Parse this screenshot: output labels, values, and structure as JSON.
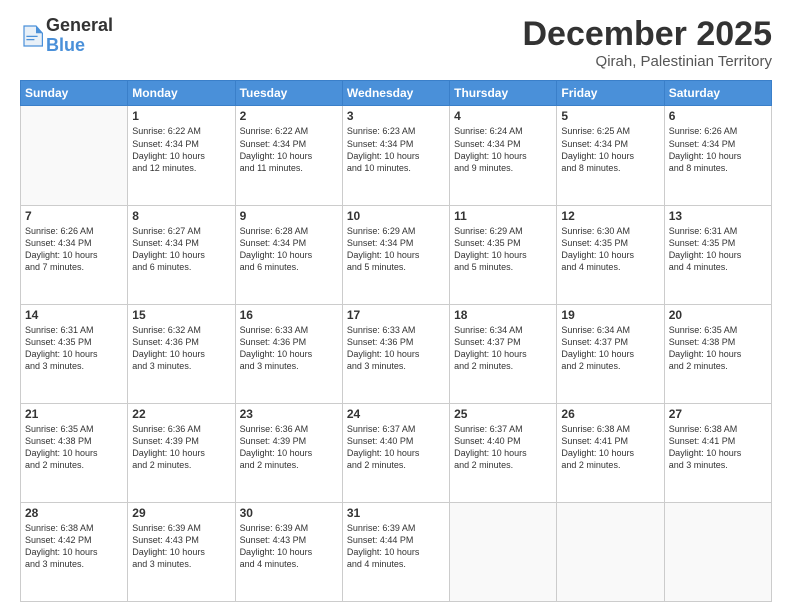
{
  "logo": {
    "general": "General",
    "blue": "Blue"
  },
  "header": {
    "title": "December 2025",
    "subtitle": "Qirah, Palestinian Territory"
  },
  "days_of_week": [
    "Sunday",
    "Monday",
    "Tuesday",
    "Wednesday",
    "Thursday",
    "Friday",
    "Saturday"
  ],
  "weeks": [
    [
      {
        "day": "",
        "info": ""
      },
      {
        "day": "1",
        "info": "Sunrise: 6:22 AM\nSunset: 4:34 PM\nDaylight: 10 hours\nand 12 minutes."
      },
      {
        "day": "2",
        "info": "Sunrise: 6:22 AM\nSunset: 4:34 PM\nDaylight: 10 hours\nand 11 minutes."
      },
      {
        "day": "3",
        "info": "Sunrise: 6:23 AM\nSunset: 4:34 PM\nDaylight: 10 hours\nand 10 minutes."
      },
      {
        "day": "4",
        "info": "Sunrise: 6:24 AM\nSunset: 4:34 PM\nDaylight: 10 hours\nand 9 minutes."
      },
      {
        "day": "5",
        "info": "Sunrise: 6:25 AM\nSunset: 4:34 PM\nDaylight: 10 hours\nand 8 minutes."
      },
      {
        "day": "6",
        "info": "Sunrise: 6:26 AM\nSunset: 4:34 PM\nDaylight: 10 hours\nand 8 minutes."
      }
    ],
    [
      {
        "day": "7",
        "info": "Sunrise: 6:26 AM\nSunset: 4:34 PM\nDaylight: 10 hours\nand 7 minutes."
      },
      {
        "day": "8",
        "info": "Sunrise: 6:27 AM\nSunset: 4:34 PM\nDaylight: 10 hours\nand 6 minutes."
      },
      {
        "day": "9",
        "info": "Sunrise: 6:28 AM\nSunset: 4:34 PM\nDaylight: 10 hours\nand 6 minutes."
      },
      {
        "day": "10",
        "info": "Sunrise: 6:29 AM\nSunset: 4:34 PM\nDaylight: 10 hours\nand 5 minutes."
      },
      {
        "day": "11",
        "info": "Sunrise: 6:29 AM\nSunset: 4:35 PM\nDaylight: 10 hours\nand 5 minutes."
      },
      {
        "day": "12",
        "info": "Sunrise: 6:30 AM\nSunset: 4:35 PM\nDaylight: 10 hours\nand 4 minutes."
      },
      {
        "day": "13",
        "info": "Sunrise: 6:31 AM\nSunset: 4:35 PM\nDaylight: 10 hours\nand 4 minutes."
      }
    ],
    [
      {
        "day": "14",
        "info": "Sunrise: 6:31 AM\nSunset: 4:35 PM\nDaylight: 10 hours\nand 3 minutes."
      },
      {
        "day": "15",
        "info": "Sunrise: 6:32 AM\nSunset: 4:36 PM\nDaylight: 10 hours\nand 3 minutes."
      },
      {
        "day": "16",
        "info": "Sunrise: 6:33 AM\nSunset: 4:36 PM\nDaylight: 10 hours\nand 3 minutes."
      },
      {
        "day": "17",
        "info": "Sunrise: 6:33 AM\nSunset: 4:36 PM\nDaylight: 10 hours\nand 3 minutes."
      },
      {
        "day": "18",
        "info": "Sunrise: 6:34 AM\nSunset: 4:37 PM\nDaylight: 10 hours\nand 2 minutes."
      },
      {
        "day": "19",
        "info": "Sunrise: 6:34 AM\nSunset: 4:37 PM\nDaylight: 10 hours\nand 2 minutes."
      },
      {
        "day": "20",
        "info": "Sunrise: 6:35 AM\nSunset: 4:38 PM\nDaylight: 10 hours\nand 2 minutes."
      }
    ],
    [
      {
        "day": "21",
        "info": "Sunrise: 6:35 AM\nSunset: 4:38 PM\nDaylight: 10 hours\nand 2 minutes."
      },
      {
        "day": "22",
        "info": "Sunrise: 6:36 AM\nSunset: 4:39 PM\nDaylight: 10 hours\nand 2 minutes."
      },
      {
        "day": "23",
        "info": "Sunrise: 6:36 AM\nSunset: 4:39 PM\nDaylight: 10 hours\nand 2 minutes."
      },
      {
        "day": "24",
        "info": "Sunrise: 6:37 AM\nSunset: 4:40 PM\nDaylight: 10 hours\nand 2 minutes."
      },
      {
        "day": "25",
        "info": "Sunrise: 6:37 AM\nSunset: 4:40 PM\nDaylight: 10 hours\nand 2 minutes."
      },
      {
        "day": "26",
        "info": "Sunrise: 6:38 AM\nSunset: 4:41 PM\nDaylight: 10 hours\nand 2 minutes."
      },
      {
        "day": "27",
        "info": "Sunrise: 6:38 AM\nSunset: 4:41 PM\nDaylight: 10 hours\nand 3 minutes."
      }
    ],
    [
      {
        "day": "28",
        "info": "Sunrise: 6:38 AM\nSunset: 4:42 PM\nDaylight: 10 hours\nand 3 minutes."
      },
      {
        "day": "29",
        "info": "Sunrise: 6:39 AM\nSunset: 4:43 PM\nDaylight: 10 hours\nand 3 minutes."
      },
      {
        "day": "30",
        "info": "Sunrise: 6:39 AM\nSunset: 4:43 PM\nDaylight: 10 hours\nand 4 minutes."
      },
      {
        "day": "31",
        "info": "Sunrise: 6:39 AM\nSunset: 4:44 PM\nDaylight: 10 hours\nand 4 minutes."
      },
      {
        "day": "",
        "info": ""
      },
      {
        "day": "",
        "info": ""
      },
      {
        "day": "",
        "info": ""
      }
    ]
  ]
}
